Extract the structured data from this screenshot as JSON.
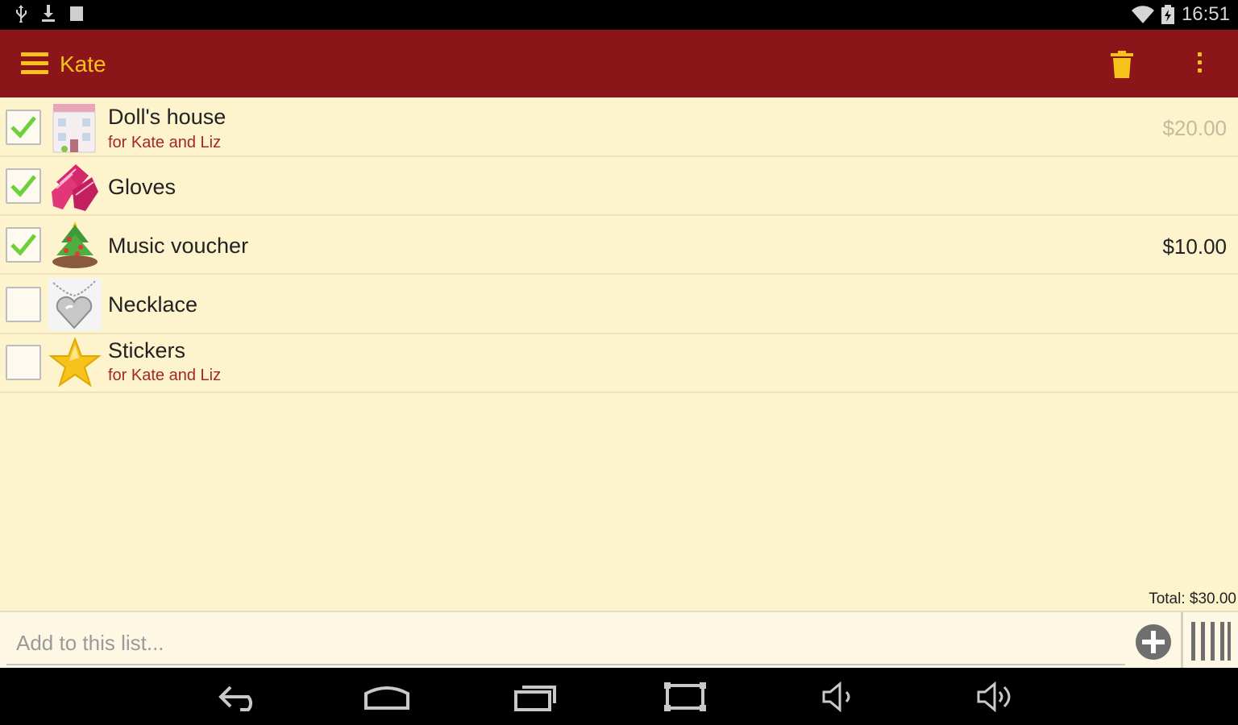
{
  "status_bar": {
    "time": "16:51",
    "left_icons": [
      "usb-icon",
      "download-icon",
      "notification-icon"
    ],
    "right_icons": [
      "wifi-icon",
      "battery-icon"
    ]
  },
  "app_bar": {
    "title": "Kate",
    "color": "#8b1519",
    "accent": "#f7c21c",
    "actions": [
      "menu-icon",
      "trash-icon",
      "more-icon"
    ]
  },
  "items": [
    {
      "name": "Doll's house",
      "note": "for Kate and Liz",
      "price": "$20.00",
      "checked": true,
      "price_muted": true,
      "icon": "dollhouse-icon"
    },
    {
      "name": "Gloves",
      "note": "",
      "price": "",
      "checked": true,
      "price_muted": false,
      "icon": "gloves-icon"
    },
    {
      "name": "Music voucher",
      "note": "",
      "price": "$10.00",
      "checked": true,
      "price_muted": false,
      "icon": "christmas-tree-icon"
    },
    {
      "name": "Necklace",
      "note": "",
      "price": "",
      "checked": false,
      "price_muted": false,
      "icon": "heart-necklace-icon"
    },
    {
      "name": "Stickers",
      "note": "for Kate and Liz",
      "price": "",
      "checked": false,
      "price_muted": false,
      "icon": "star-icon"
    }
  ],
  "footer": {
    "total": "Total: $30.00",
    "add_placeholder": "Add to this list..."
  },
  "nav_bar": {
    "buttons": [
      "back-icon",
      "home-icon",
      "recents-icon",
      "screenshot-icon",
      "volume-down-icon",
      "volume-up-icon"
    ]
  }
}
